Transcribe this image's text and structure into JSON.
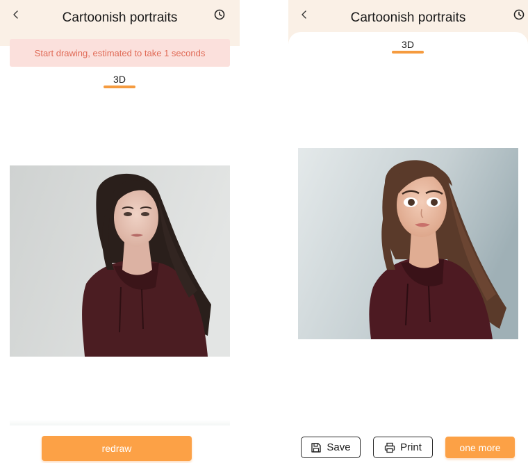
{
  "left_screen": {
    "header": {
      "title": "Cartoonish portraits",
      "back_icon": "chevron-left-icon",
      "history_icon": "clock-icon"
    },
    "notice": "Start drawing, estimated to take 1 seconds",
    "tabs": [
      {
        "label": "3D",
        "active": true
      }
    ],
    "image": {
      "type": "original-photo"
    },
    "buttons": {
      "redraw": "redraw"
    }
  },
  "right_screen": {
    "header": {
      "title": "Cartoonish portraits",
      "back_icon": "chevron-left-icon",
      "history_icon": "clock-icon"
    },
    "tabs": [
      {
        "label": "3D",
        "active": true
      }
    ],
    "image": {
      "type": "3d-cartoon-result"
    },
    "buttons": {
      "save": "Save",
      "save_icon": "floppy-disk-icon",
      "print": "Print",
      "print_icon": "printer-icon",
      "one_more": "one more"
    }
  },
  "colors": {
    "accent": "#fca146",
    "tab_underline": "#f59b3f",
    "header_bg": "#faf0e6",
    "notice_bg": "#fbe0dc",
    "notice_text": "#e06a56"
  }
}
